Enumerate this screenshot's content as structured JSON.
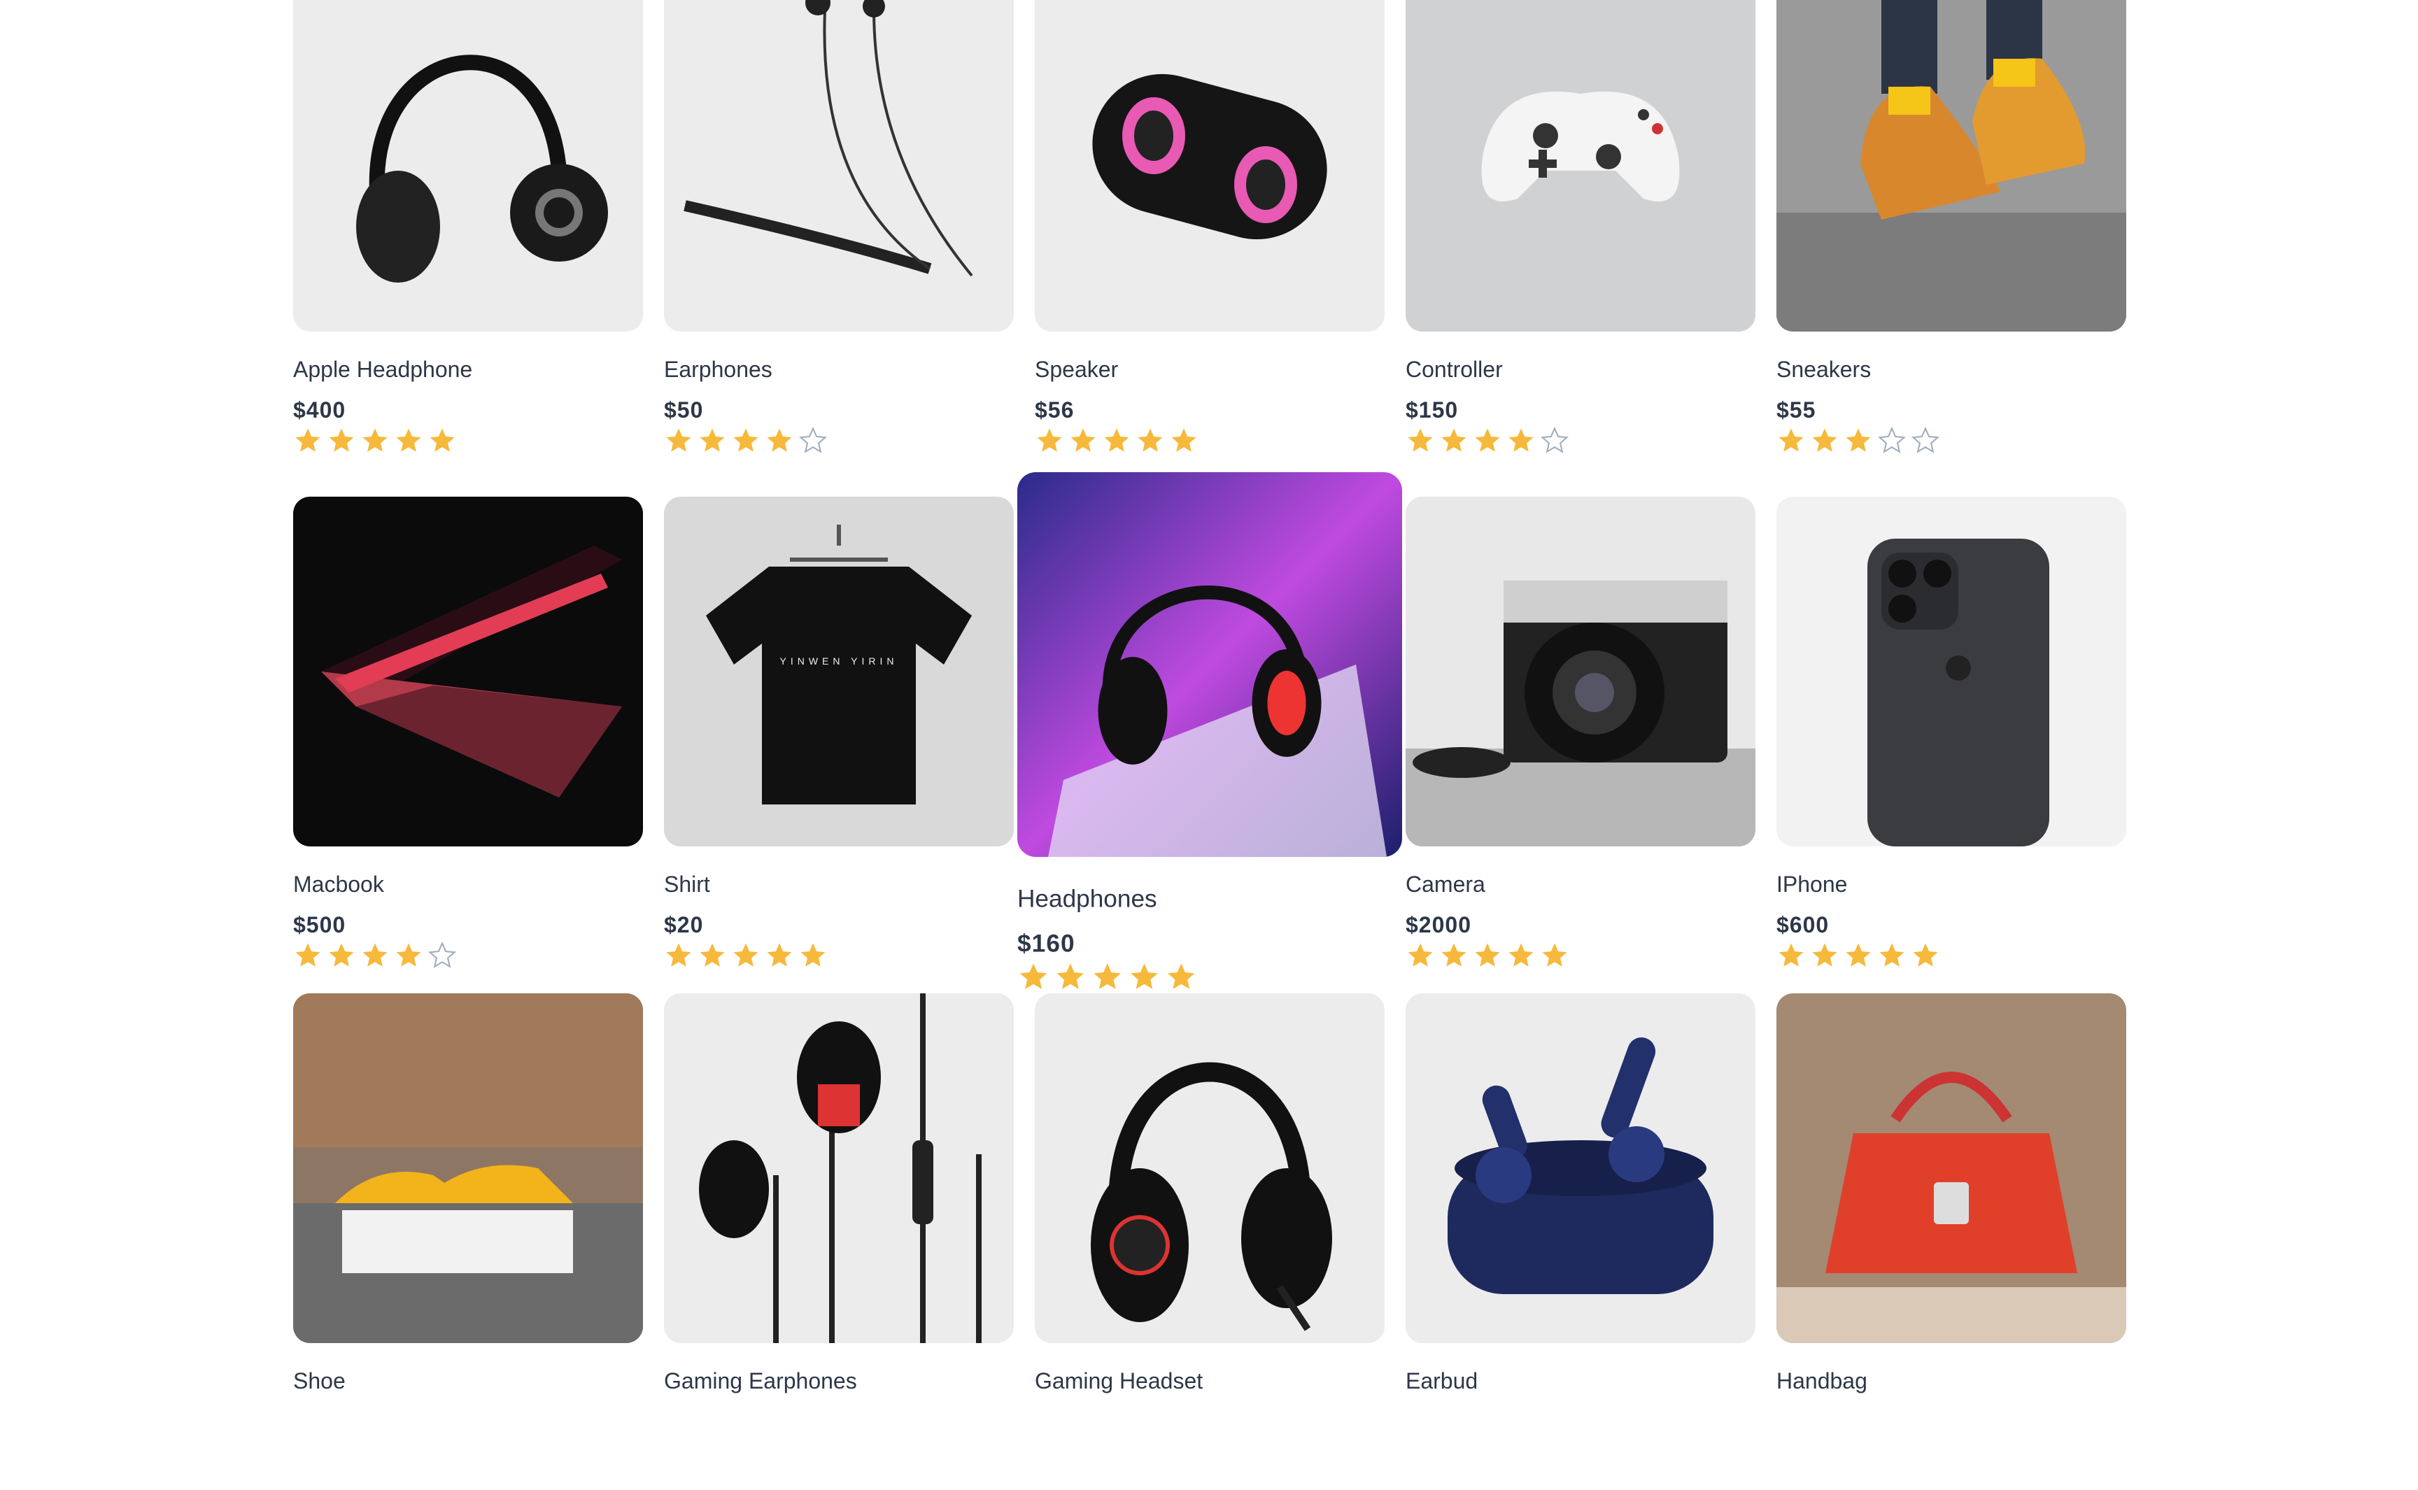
{
  "colors": {
    "star_filled": "#f6b93b",
    "star_empty": "#a0aec0",
    "text": "#2d3748",
    "thumb_bg": "#ebebeb"
  },
  "products": [
    {
      "name": "Apple Headphone",
      "price": "$400",
      "rating": 5,
      "icon": "headphone-image"
    },
    {
      "name": "Earphones",
      "price": "$50",
      "rating": 4,
      "icon": "earphones-image"
    },
    {
      "name": "Speaker",
      "price": "$56",
      "rating": 5,
      "icon": "speaker-image"
    },
    {
      "name": "Controller",
      "price": "$150",
      "rating": 4,
      "icon": "controller-image"
    },
    {
      "name": "Sneakers",
      "price": "$55",
      "rating": 3,
      "icon": "sneakers-image"
    },
    {
      "name": "Macbook",
      "price": "$500",
      "rating": 4,
      "icon": "macbook-image"
    },
    {
      "name": "Shirt",
      "price": "$20",
      "rating": 5,
      "icon": "shirt-image"
    },
    {
      "name": "Headphones",
      "price": "$160",
      "rating": 5,
      "icon": "headphones-image",
      "hovered": true
    },
    {
      "name": "Camera",
      "price": "$2000",
      "rating": 5,
      "icon": "camera-image"
    },
    {
      "name": "IPhone",
      "price": "$600",
      "rating": 5,
      "icon": "iphone-image"
    },
    {
      "name": "Shoe",
      "price": "",
      "rating": 0,
      "icon": "shoe-image"
    },
    {
      "name": "Gaming Earphones",
      "price": "",
      "rating": 0,
      "icon": "gaming-earphones-image"
    },
    {
      "name": "Gaming Headset",
      "price": "",
      "rating": 0,
      "icon": "gaming-headset-image"
    },
    {
      "name": "Earbud",
      "price": "",
      "rating": 0,
      "icon": "earbud-image"
    },
    {
      "name": "Handbag",
      "price": "",
      "rating": 0,
      "icon": "handbag-image"
    }
  ]
}
